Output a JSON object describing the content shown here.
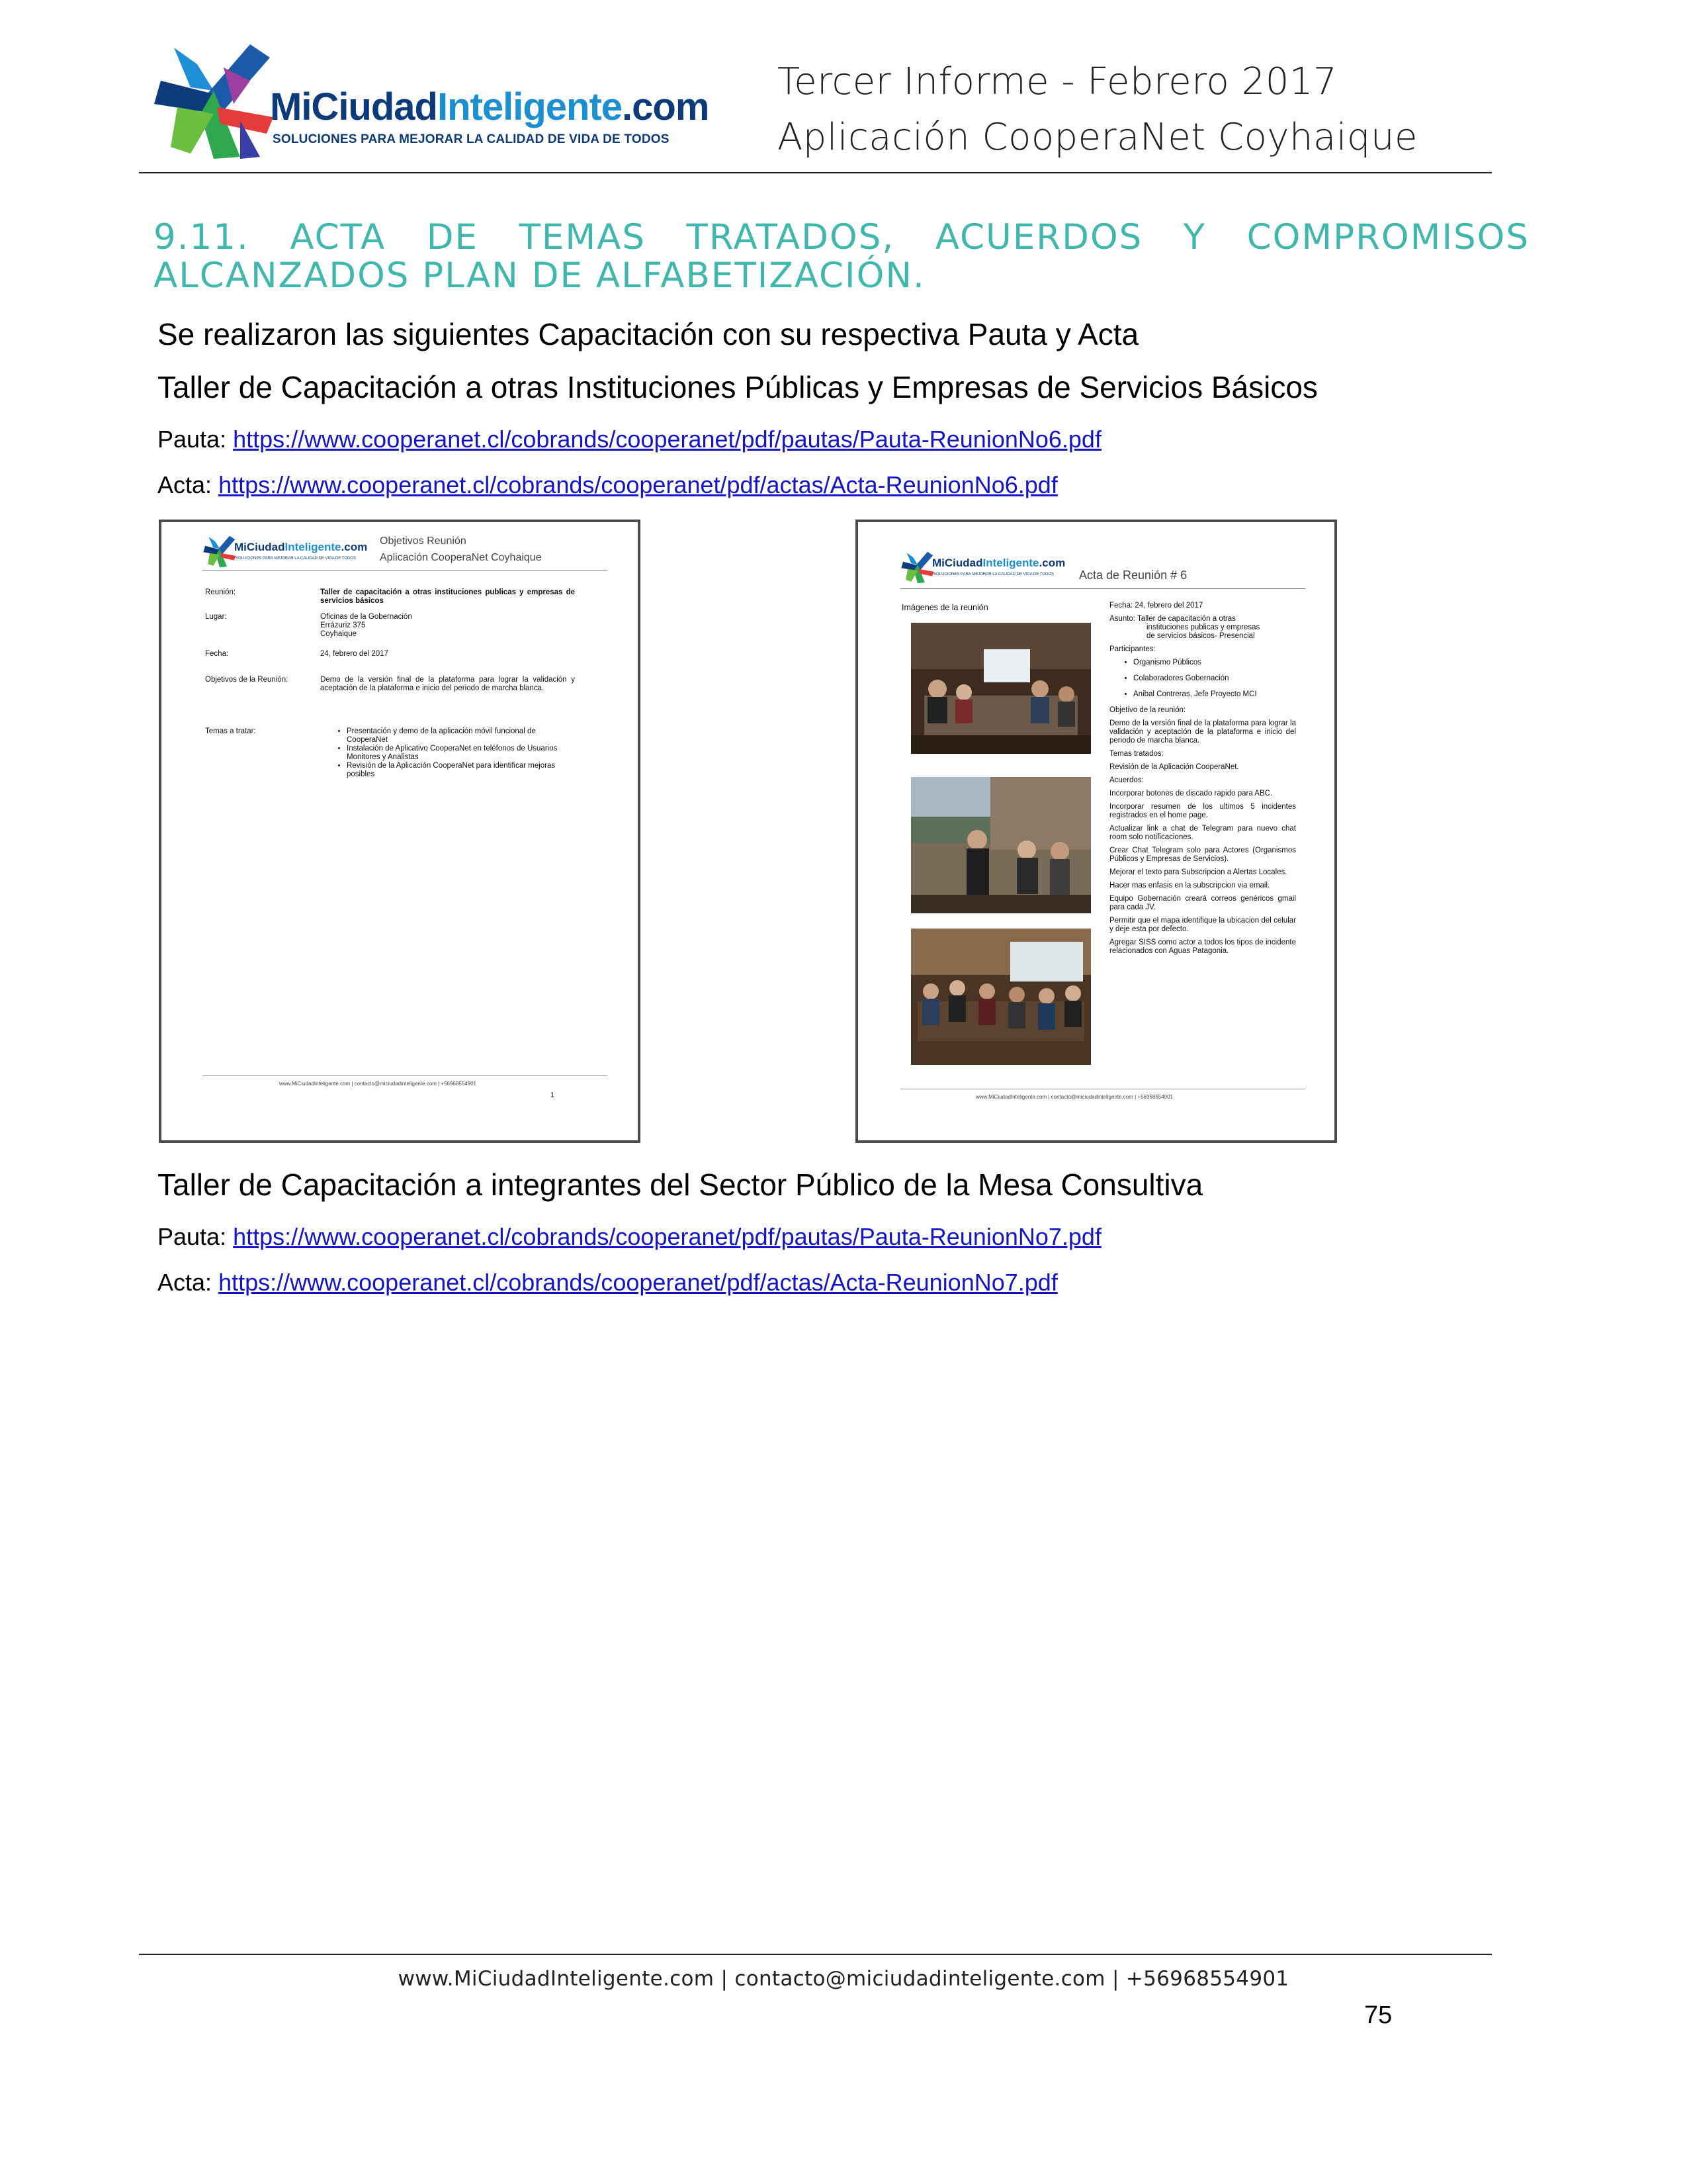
{
  "header": {
    "logo": {
      "name_part1": "MiCiudad",
      "name_part2": "Inteligente",
      "name_part3": ".com",
      "tagline": "SOLUCIONES PARA MEJORAR LA CALIDAD DE VIDA DE TODOS"
    },
    "title_line1": "Tercer Informe - Febrero 2017",
    "title_line2": "Aplicación CooperaNet Coyhaique"
  },
  "section": {
    "heading": "9.11. ACTA DE TEMAS TRATADOS, ACUERDOS Y COMPROMISOS ALCANZADOS PLAN DE ALFABETIZACIÓN."
  },
  "intro": "Se realizaron las siguientes Capacitación con su respectiva Pauta y Acta",
  "workshop1": {
    "title": "Taller de Capacitación a otras Instituciones Públicas y Empresas de Servicios Básicos",
    "pauta_label": "Pauta:",
    "pauta_url": "https://www.cooperanet.cl/cobrands/cooperanet/pdf/pautas/Pauta-ReunionNo6.pdf",
    "acta_label": "Acta:",
    "acta_url": "https://www.cooperanet.cl/cobrands/cooperanet/pdf/actas/Acta-ReunionNo6.pdf"
  },
  "pauta_doc": {
    "logo_name1": "MiCiudad",
    "logo_name2": "Inteligente",
    "logo_name3": ".com",
    "logo_tag": "SOLUCIONES PARA MEJORAR LA CALIDAD DE VIDA DE TODOS",
    "header_line1": "Objetivos Reunión",
    "header_line2": "Aplicación CooperaNet Coyhaique",
    "rows": [
      {
        "label": "Reunión:",
        "value": "Taller de capacitación a otras instituciones publicas y empresas de servicios básicos"
      },
      {
        "label": "Lugar:",
        "value_lines": [
          "Oficinas de la Gobernación",
          "Errázuriz 375",
          "Coyhaique"
        ]
      },
      {
        "label": "Fecha:",
        "value": "24, febrero del 2017"
      },
      {
        "label": "Objetivos de la Reunión:",
        "value": "Demo de la versión final de la plataforma para lograr la validación y aceptación de la plataforma e inicio del periodo de marcha blanca."
      },
      {
        "label": "Temas a tratar:",
        "items": [
          "Presentación y demo de la aplicación móvil funcional de CooperaNet",
          "Instalación de Aplicativo CooperaNet en teléfonos de Usuarios Monitores y Analistas",
          "Revisión de la Aplicación CooperaNet para identificar mejoras posibles"
        ]
      }
    ],
    "footer": "www.MiCiudadInteligente.com | contacto@miciudadinteligente.com | +56968554901",
    "page": "1"
  },
  "acta_doc": {
    "logo_name1": "MiCiudad",
    "logo_name2": "Inteligente",
    "logo_name3": ".com",
    "logo_tag": "SOLUCIONES PARA MEJORAR LA CALIDAD DE VIDA DE TODOS",
    "header": "Acta de Reunión # 6",
    "images_label": "Imágenes de la reunión",
    "fecha": "Fecha: 24, febrero del 2017",
    "asunto": "Asunto: Taller de capacitación a otras",
    "asunto_cont1": "instituciones publicas y empresas",
    "asunto_cont2": "de servicios básicos- Presencial",
    "participantes_label": "Participantes:",
    "participantes": [
      "Organismo Públicos",
      "Colaboradores Gobernación",
      "Anibal Contreras, Jefe Proyecto MCI"
    ],
    "objetivo_label": "Objetivo de la reunión:",
    "objetivo": "Demo de la versión final de la plataforma para lograr la validación y aceptación de la plataforma e inicio del periodo de marcha blanca.",
    "temas_label": "Temas tratados:",
    "temas": "Revisión de la Aplicación CooperaNet.",
    "acuerdos_label": "Acuerdos:",
    "acuerdos": [
      "Incorporar botones de discado rapido para ABC.",
      "Incorporar resumen de los ultimos 5 incidentes registrados en el home page.",
      "Actualizar link a chat de Telegram para nuevo chat room solo notificaciones.",
      "Crear Chat Telegram solo para Actores (Organismos Públicos y Empresas de Servicios).",
      "Mejorar el texto para Subscripcion a Alertas Locales.",
      "Hacer mas enfasis en la subscripcion via email.",
      "Equipo Gobernación creará correos genéricos gmail para cada JV.",
      "Permitir que el mapa identifique la ubicacion del celular y deje esta por defecto.",
      "Agregar SISS como actor a todos los tipos de incidente relacionados con Aguas Patagonia."
    ],
    "footer": "www.MiCiudadInteligente.com | contacto@miciudadinteligente.com | +56968554901"
  },
  "workshop2": {
    "title": "Taller de Capacitación a integrantes del Sector Público de la Mesa Consultiva",
    "pauta_label": "Pauta:",
    "pauta_url": "https://www.cooperanet.cl/cobrands/cooperanet/pdf/pautas/Pauta-ReunionNo7.pdf",
    "acta_label": "Acta:",
    "acta_url": "https://www.cooperanet.cl/cobrands/cooperanet/pdf/actas/Acta-ReunionNo7.pdf"
  },
  "footer": {
    "text": "www.MiCiudadInteligente.com | contacto@miciudadinteligente.com | +56968554901",
    "page_number": "75"
  },
  "colors": {
    "heading": "#3fb7ad",
    "link": "#1414c8",
    "logo_dark": "#0d3a7a",
    "logo_light": "#1a8fd1"
  }
}
